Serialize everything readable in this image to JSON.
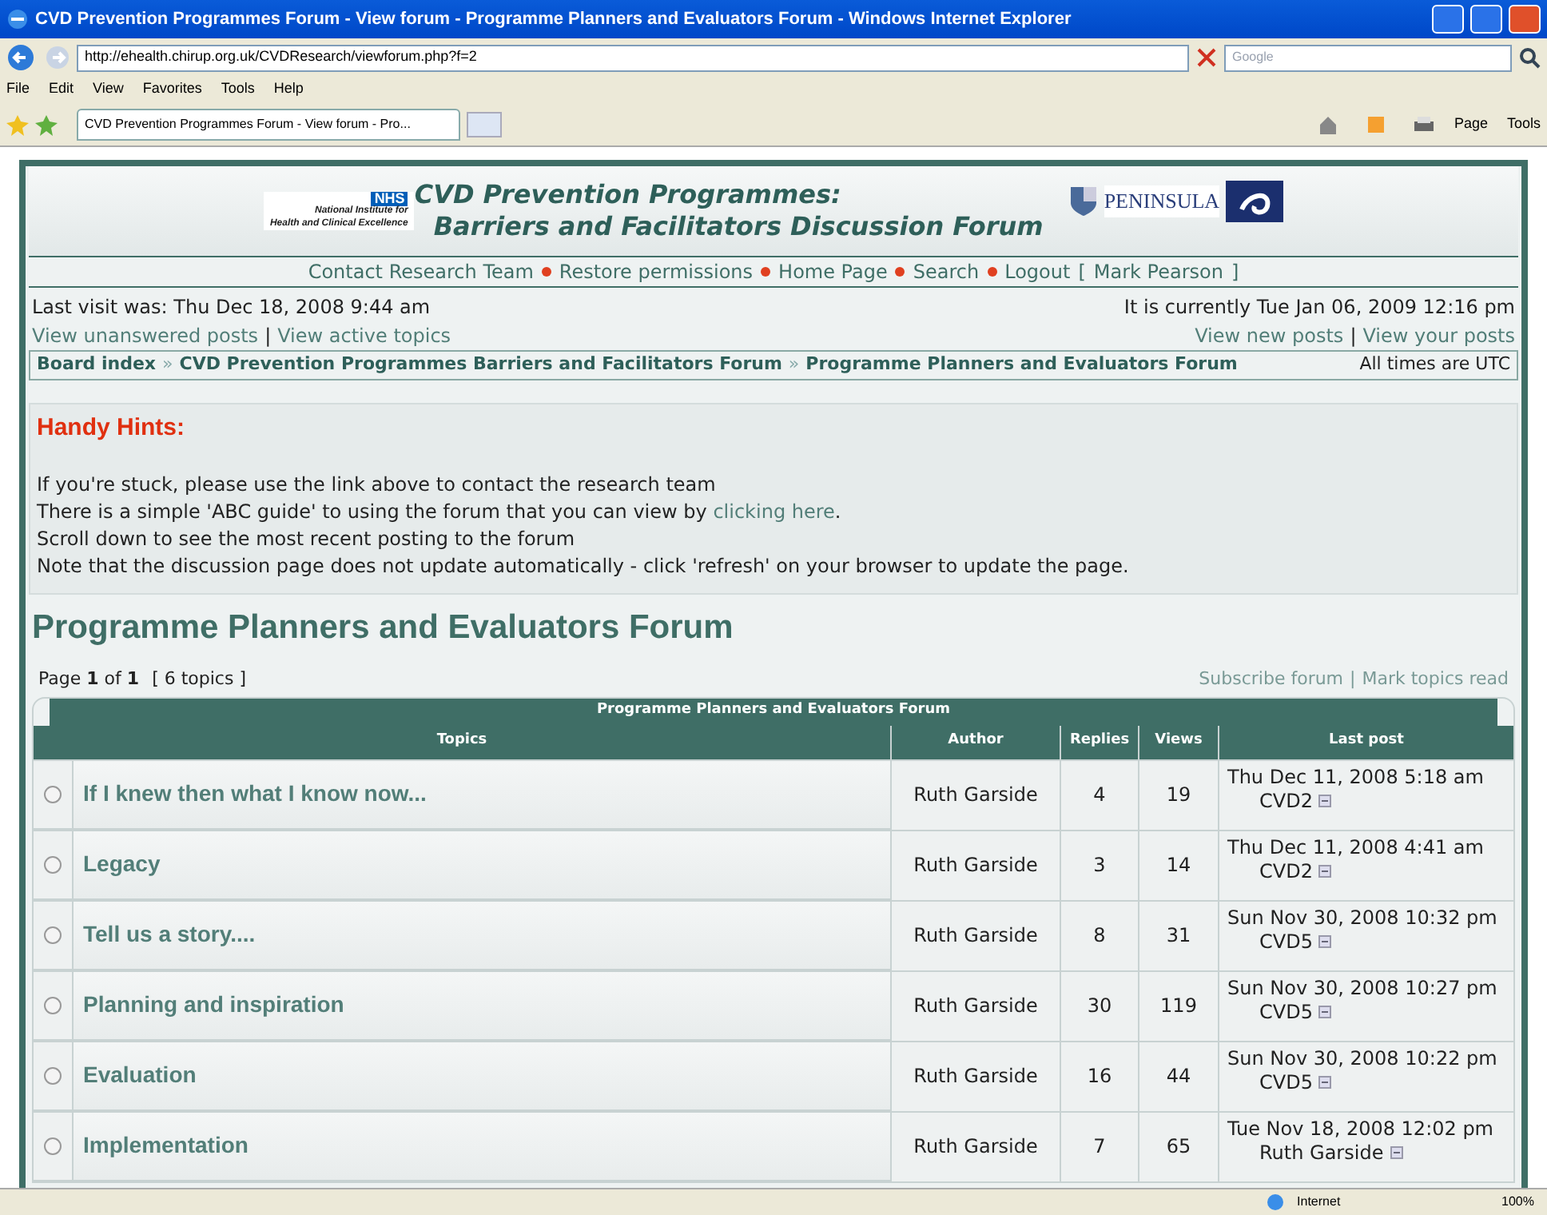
{
  "browser": {
    "title": "CVD Prevention Programmes Forum - View forum - Programme Planners and Evaluators Forum - Windows Internet Explorer",
    "url": "http://ehealth.chirup.org.uk/CVDResearch/viewforum.php?f=2",
    "search_placeholder": "Google",
    "menu": [
      "File",
      "Edit",
      "View",
      "Favorites",
      "Tools",
      "Help"
    ],
    "tab_title": "CVD Prevention Programmes Forum - View forum - Pro...",
    "toolbar": [
      "Page",
      "Tools"
    ]
  },
  "header": {
    "nhs": "NHS",
    "institute_lines": [
      "National Institute for",
      "Health and Clinical Excellence"
    ],
    "title_lines": [
      "CVD Prevention Programmes:",
      "Barriers and Facilitators Discussion Forum"
    ],
    "partner": "PENINSULA"
  },
  "nav": {
    "links": [
      "Contact Research Team",
      "Restore permissions",
      "Home Page",
      "Search",
      "Logout"
    ],
    "user_open": "[",
    "user": "Mark Pearson",
    "user_close": "]"
  },
  "info": {
    "last_visit": "Last visit was: Thu Dec 18, 2008 9:44 am",
    "current_time": "It is currently Tue Jan 06, 2009 12:16 pm",
    "left_links": [
      "View unanswered posts",
      "View active topics"
    ],
    "right_links": [
      "View new posts",
      "View your posts"
    ],
    "separator": "|"
  },
  "breadcrumb": {
    "items": [
      "Board index",
      "CVD Prevention Programmes Barriers and Facilitators Forum",
      "Programme Planners and Evaluators Forum"
    ],
    "separator": "»",
    "timezone": "All times are UTC"
  },
  "hints": {
    "title": "Handy Hints:",
    "lines": [
      {
        "text": "If you're stuck, please use the link above to contact the research team"
      },
      {
        "text": "There is a simple 'ABC guide' to using the forum that you can view by ",
        "link": "clicking here",
        "after": "."
      },
      {
        "text": "Scroll down to see the most recent posting to the forum"
      },
      {
        "text": "Note that the discussion page does not update automatically - click 'refresh' on your browser to update the page."
      }
    ]
  },
  "forum_title": "Programme Planners and Evaluators Forum",
  "pagination": {
    "page": "Page **1** of **1**",
    "topics": "[ 6 topics ]",
    "links": [
      "Subscribe forum",
      "Mark topics read"
    ],
    "separator": "|"
  },
  "table": {
    "caption": "Programme Planners and Evaluators Forum",
    "columns": [
      "Topics",
      "Author",
      "Replies",
      "Views",
      "Last post"
    ],
    "rows": [
      {
        "topic": "If I knew then what I know now...",
        "author": "Ruth Garside",
        "replies": "4",
        "views": "19",
        "last_post_time": "Thu Dec 11, 2008 5:18 am",
        "last_post_by": "CVD2"
      },
      {
        "topic": "Legacy",
        "author": "Ruth Garside",
        "replies": "3",
        "views": "14",
        "last_post_time": "Thu Dec 11, 2008 4:41 am",
        "last_post_by": "CVD2"
      },
      {
        "topic": "Tell us a story....",
        "author": "Ruth Garside",
        "replies": "8",
        "views": "31",
        "last_post_time": "Sun Nov 30, 2008 10:32 pm",
        "last_post_by": "CVD5"
      },
      {
        "topic": "Planning and inspiration",
        "author": "Ruth Garside",
        "replies": "30",
        "views": "119",
        "last_post_time": "Sun Nov 30, 2008 10:27 pm",
        "last_post_by": "CVD5"
      },
      {
        "topic": "Evaluation",
        "author": "Ruth Garside",
        "replies": "16",
        "views": "44",
        "last_post_time": "Sun Nov 30, 2008 10:22 pm",
        "last_post_by": "CVD5"
      },
      {
        "topic": "Implementation",
        "author": "Ruth Garside",
        "replies": "7",
        "views": "65",
        "last_post_time": "Tue Nov 18, 2008 12:02 pm",
        "last_post_by": "Ruth Garside"
      }
    ]
  },
  "status_bar": {
    "zone": "Internet",
    "zoom": "100%"
  }
}
